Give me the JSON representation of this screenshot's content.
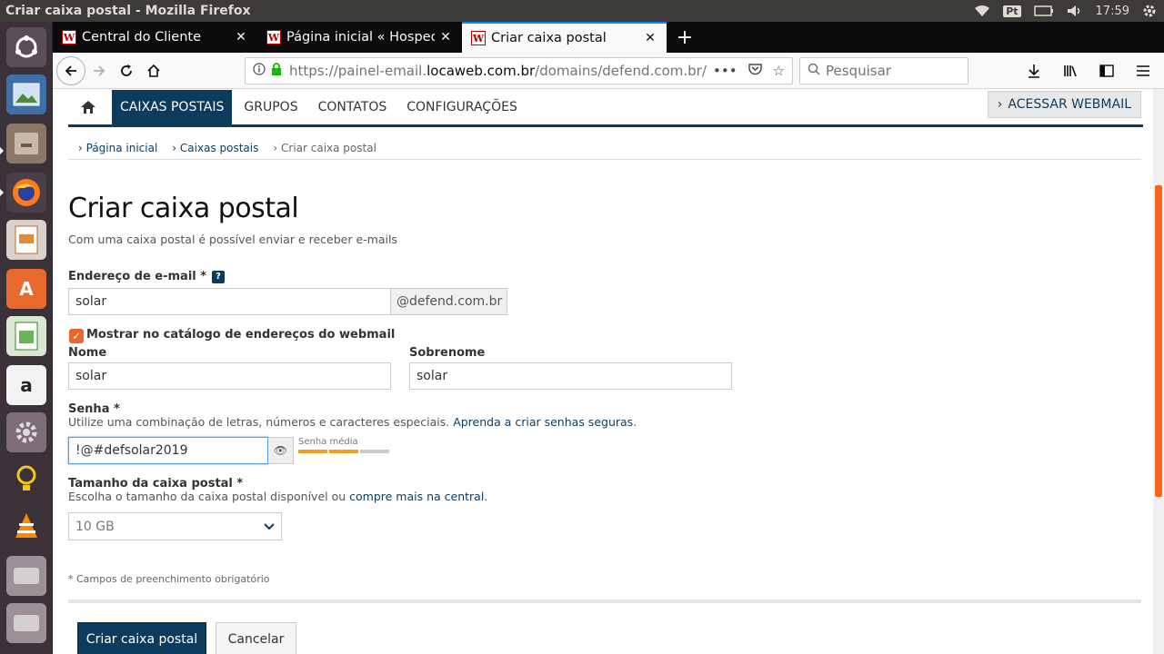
{
  "os": {
    "window_title": "Criar caixa postal - Mozilla Firefox",
    "keyboard_layout": "Pt",
    "clock": "17:59"
  },
  "browser": {
    "tabs": [
      {
        "label": "Central do Cliente"
      },
      {
        "label": "Página inicial « Hospedagem"
      },
      {
        "label": "Criar caixa postal"
      }
    ],
    "url_prefix": "https://painel-email.",
    "url_domain": "locaweb.com.br",
    "url_path": "/domains/defend.com.br/",
    "search_placeholder": "Pesquisar"
  },
  "nav": {
    "items": [
      "CAIXAS POSTAIS",
      "GRUPOS",
      "CONTATOS",
      "CONFIGURAÇÕES"
    ],
    "webmail": "ACESSAR WEBMAIL"
  },
  "breadcrumb": [
    "Página inicial",
    "Caixas postais",
    "Criar caixa postal"
  ],
  "form": {
    "title": "Criar caixa postal",
    "subtitle": "Com uma caixa postal é possível enviar e receber e-mails",
    "email_label": "Endereço de e-mail *",
    "email_help": "?",
    "email_value": "solar",
    "email_suffix": "@defend.com.br",
    "catalog_label": "Mostrar no catálogo de endereços do webmail",
    "catalog_checked": true,
    "first_name_label": "Nome",
    "first_name_value": "solar",
    "last_name_label": "Sobrenome",
    "last_name_value": "solar",
    "password_label": "Senha *",
    "password_hint": "Utilize uma combinação de letras, números e caracteres especiais.",
    "password_link": "Aprenda a criar senhas seguras",
    "password_value": "!@#defsolar2019",
    "strength_label": "Senha média",
    "strength_level": 0.67,
    "size_label": "Tamanho da caixa postal *",
    "size_hint": "Escolha o tamanho da caixa postal disponível ou",
    "size_link": "compre mais na central",
    "size_value": "10 GB",
    "required_note": "* Campos de preenchimento obrigatório",
    "submit": "Criar caixa postal",
    "cancel": "Cancelar"
  },
  "colors": {
    "primary": "#0c3b5e",
    "accent": "#e8682b"
  }
}
